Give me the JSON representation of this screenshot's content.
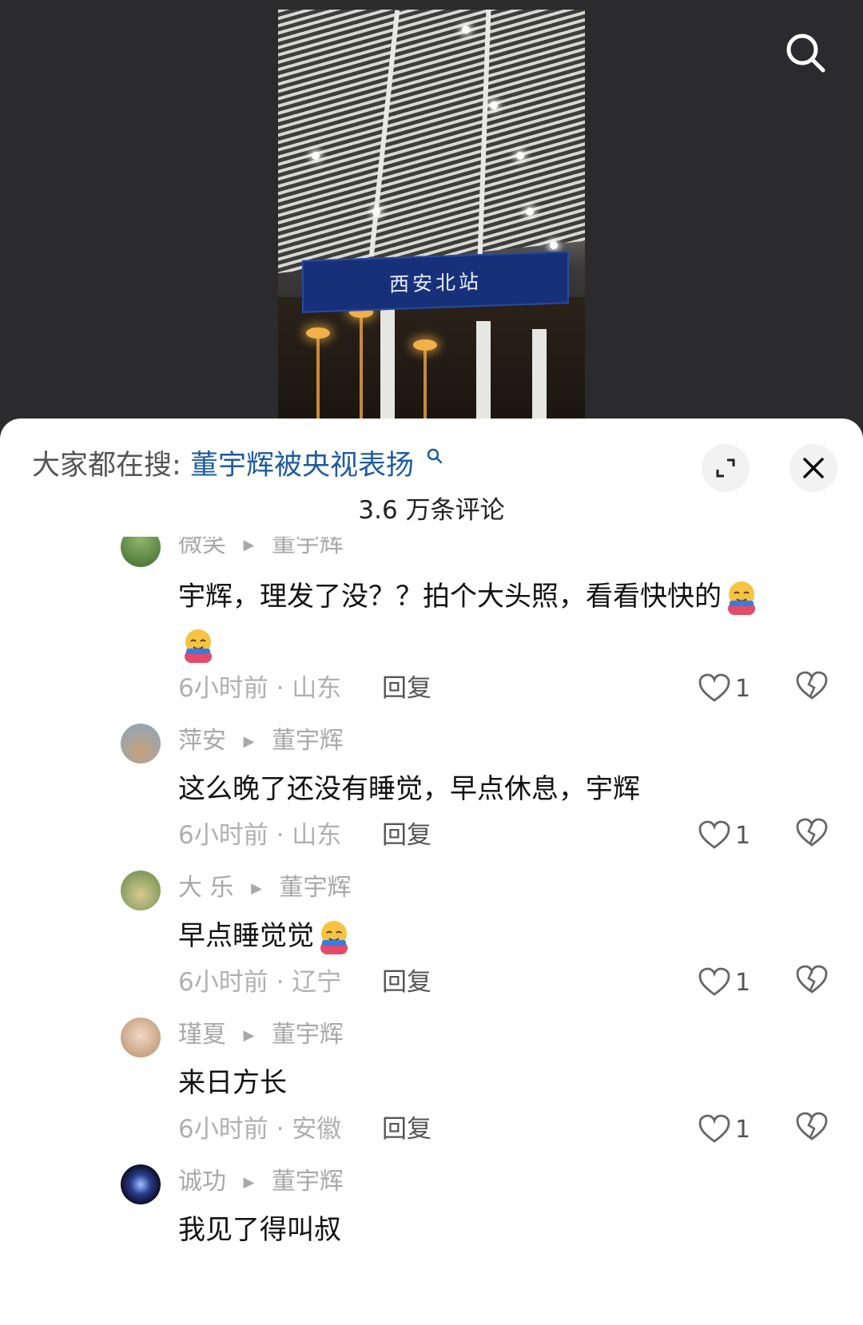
{
  "video": {
    "station_sign": "西安北站"
  },
  "sheet": {
    "search_label": "大家都在搜:",
    "search_topic": "董宇辉被央视表扬",
    "comment_count": "3.6 万条评论"
  },
  "icons": {
    "search": "search-icon",
    "expand": "expand-icon",
    "close": "close-icon",
    "like": "heart-icon",
    "dislike": "broken-heart-icon",
    "emoji": "hugging-face-emoji"
  },
  "colors": {
    "topic_link": "#1f5c9c",
    "meta_gray": "#a8a8a8",
    "sheet_bg": "#ffffff",
    "video_bg": "#2b2b2d"
  },
  "comments": [
    {
      "user": "微笑",
      "reply_to": "董宇辉",
      "text": "宇辉，理发了没？？拍个大头照，看看快快的",
      "time_location": "6小时前 · 山东",
      "reply": "回复",
      "likes": "1"
    },
    {
      "user": "萍安",
      "reply_to": "董宇辉",
      "text": "这么晚了还没有睡觉，早点休息，宇辉",
      "time_location": "6小时前 · 山东",
      "reply": "回复",
      "likes": "1"
    },
    {
      "user": "大 乐",
      "reply_to": "董宇辉",
      "text": "早点睡觉觉",
      "time_location": "6小时前 · 辽宁",
      "reply": "回复",
      "likes": "1"
    },
    {
      "user": "瑾夏",
      "reply_to": "董宇辉",
      "text": "来日方长",
      "time_location": "6小时前 · 安徽",
      "reply": "回复",
      "likes": "1"
    },
    {
      "user": "诚功",
      "reply_to": "董宇辉",
      "text": "我见了得叫叔"
    }
  ]
}
